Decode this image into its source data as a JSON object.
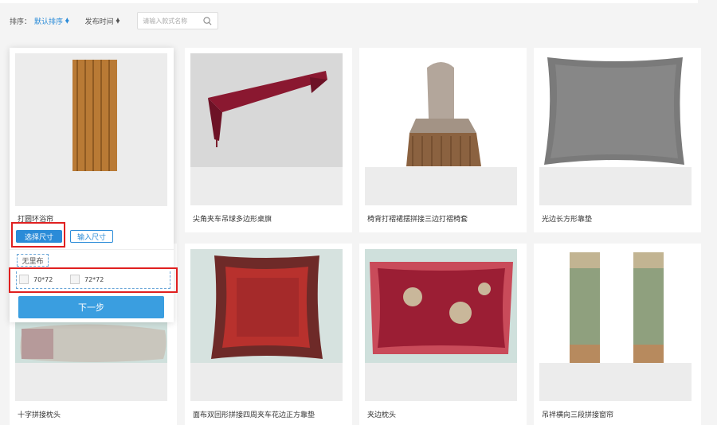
{
  "sort": {
    "label": "排序：",
    "default_label": "默认排序",
    "time_label": "发布时间",
    "search_placeholder": "请输入款式名称"
  },
  "popup": {
    "product_name": "打圆环浴帘",
    "select_size_label": "选择尺寸",
    "input_size_label": "输入尺寸",
    "lining_tag": "无里布",
    "size_options": [
      "70*72",
      "72*72"
    ],
    "next_label": "下一步"
  },
  "products": [
    {
      "name": "尖角夹车吊球多边形桌旗",
      "thumb_color": "#d8d8d8"
    },
    {
      "name": "椅背打褶裙摆拼接三边打褶椅套",
      "thumb_color": "#ffffff"
    },
    {
      "name": "光边长方形靠垫",
      "thumb_color": "#ffffff"
    },
    {
      "name": "十字拼接枕头",
      "thumb_color": "#cfe0dc"
    },
    {
      "name": "面布双回形拼接四周夹车花边正方靠垫",
      "thumb_color": "#d6e2df"
    },
    {
      "name": "夹边枕头",
      "thumb_color": "#cfe0dc"
    },
    {
      "name": "吊袢横向三段拼接窗帘",
      "thumb_color": "#ffffff"
    }
  ]
}
